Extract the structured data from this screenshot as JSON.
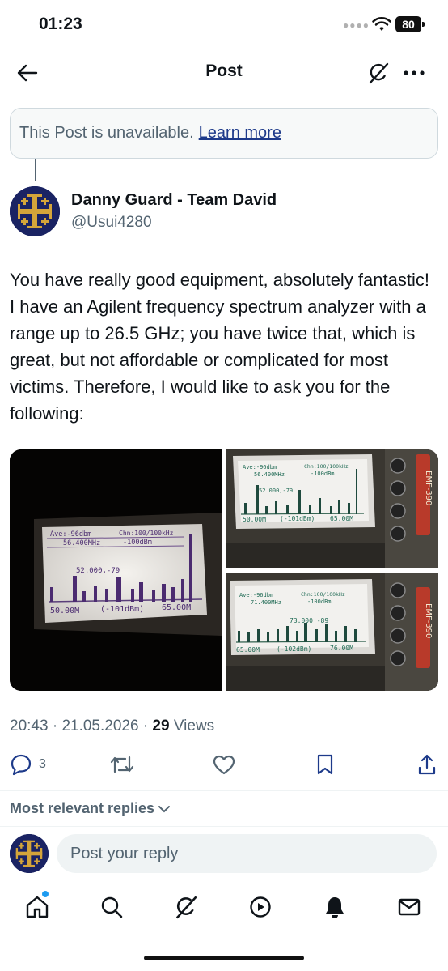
{
  "status_bar": {
    "time": "01:23",
    "battery": "80"
  },
  "nav": {
    "title": "Post"
  },
  "notice": {
    "text": "This Post is unavailable.",
    "link": "Learn more"
  },
  "author": {
    "name": "Danny Guard - Team David",
    "handle": "@Usui4280"
  },
  "post": {
    "text": "You have really good equipment, absolutely fantastic! I have an Agilent frequency spectrum analyzer with a range up to 26.5 GHz; you have twice that, which is great, but not affordable or complicated for most victims. Therefore, I would like to ask you for the following:"
  },
  "media": [
    {
      "header_left": "Ave:-96dbm",
      "header_right": "Chn:100/100kHz",
      "freq": "56.400MHz",
      "level": "-100dBm",
      "marker": "52.000,-79",
      "footer_left": "50.00M",
      "footer_mid": "(-101dBm)",
      "footer_right": "65.00M"
    },
    {
      "header_left": "Ave:-96dbm",
      "header_right": "Chn:100/100kHz",
      "freq": "56.400MHz",
      "level": "-100dBm",
      "marker": "52.000,-79",
      "footer_left": "50.00M",
      "footer_mid": "(-101dBm)",
      "footer_right": "65.00M",
      "device": "EMF-390"
    },
    {
      "header_left": "Ave:-96dbm",
      "header_right": "Chn:100/100kHz",
      "freq": "71.400MHz",
      "level": "-100dBm",
      "marker": "73.000 -89",
      "footer_left": "65.00M",
      "footer_mid": "(-102dBm)",
      "footer_right": "76.00M",
      "device": "EMF-390"
    }
  ],
  "meta": {
    "time": "20:43",
    "date": "21.05.2026",
    "views_count": "29",
    "views_label": "Views"
  },
  "actions": {
    "replies": "3"
  },
  "replies_filter": "Most relevant replies",
  "reply_box": {
    "placeholder": "Post your reply"
  },
  "icons": {
    "back": "arrow-left-icon",
    "grok": "grok-icon",
    "more": "more-icon",
    "reply": "reply-icon",
    "repost": "repost-icon",
    "like": "heart-icon",
    "bookmark": "bookmark-icon",
    "share": "share-icon",
    "home": "home-icon",
    "search": "search-icon",
    "video": "play-icon",
    "notifications": "bell-icon",
    "messages": "mail-icon"
  },
  "colors": {
    "link": "#1d3a8a",
    "notification_dot": "#1d9bf0",
    "avatar_bg": "#1a2363",
    "avatar_cross": "#d4a53a"
  }
}
